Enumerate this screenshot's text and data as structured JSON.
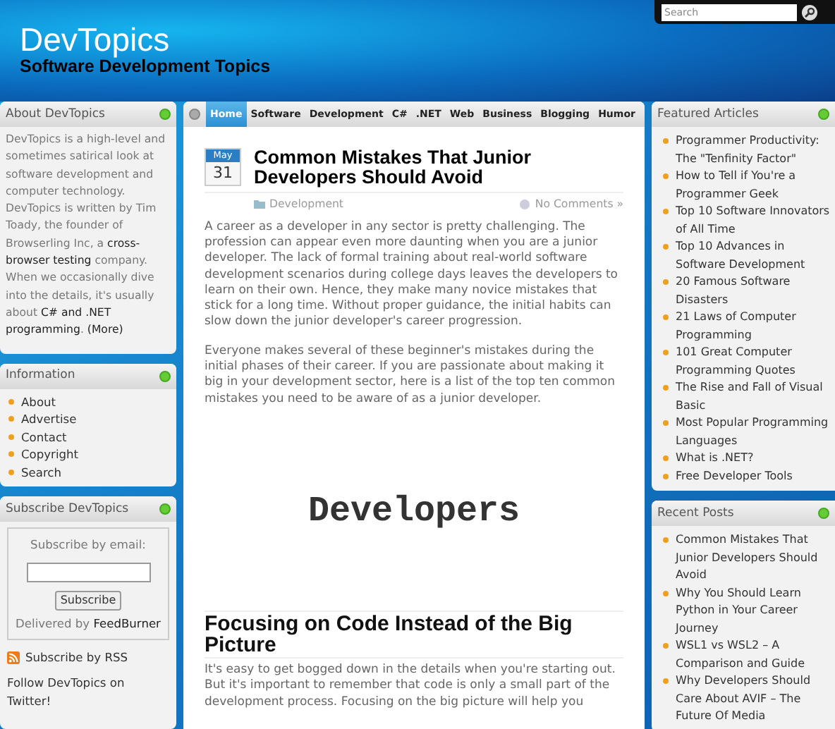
{
  "header": {
    "title": "DevTopics",
    "tagline": "Software Development Topics",
    "search": {
      "placeholder": "Search"
    }
  },
  "nav": [
    {
      "label": "Home",
      "selected": true
    },
    {
      "label": "Software",
      "selected": false
    },
    {
      "label": "Development",
      "selected": false
    },
    {
      "label": "C#",
      "selected": false
    },
    {
      "label": ".NET",
      "selected": false
    },
    {
      "label": "Web",
      "selected": false
    },
    {
      "label": "Business",
      "selected": false
    },
    {
      "label": "Blogging",
      "selected": false
    },
    {
      "label": "Humor",
      "selected": false
    }
  ],
  "left_sidebar": [
    {
      "kind": "text",
      "title": "About DevTopics",
      "body": "DevTopics is a high-level and sometimes satirical look at software development and computer technology. DevTopics is written by Tim Toady, the founder of Browserling Inc, a **cross-browser testing** company. When we occasionally dive into the details, it's usually about **C# and .NET programming**. **(More)**"
    },
    {
      "kind": "list",
      "title": "Information",
      "items": [
        "About",
        "Advertise",
        "Contact",
        "Copyright",
        "Search"
      ]
    },
    {
      "kind": "subscribe",
      "title": "Subscribe DevTopics",
      "prompt": "Subscribe by email:",
      "button": "Subscribe",
      "delivered": "Delivered by **FeedBurner**",
      "rss": "Subscribe by RSS",
      "follow": "Follow DevTopics on Twitter!"
    }
  ],
  "post": {
    "date": {
      "month": "May",
      "day": "31"
    },
    "title": "Common Mistakes That Junior Developers Should Avoid",
    "category": "Development",
    "comments": "No Comments »",
    "paragraphs": [
      "A career as a developer in any sector is pretty challenging. The profession can appear even more daunting when you are a junior developer. The lack of formal training about real-world software development scenarios during college days leaves the developers to learn on their own. Hence, they make many novice mistakes that stick for a long time. Without proper guidance, the initial habits can slow down the junior developer's career progression.",
      "Everyone makes several of these beginner's mistakes during the initial phases of their career. If you are passionate about making it big in your development sector, here is a list of the top ten common mistakes you need to be aware of as a junior developer."
    ],
    "figure_text": "Developers",
    "section_heading": "Focusing on Code Instead of the Big Picture",
    "section_paragraph": "It's easy to get bogged down in the details when you're starting out. But it's important to remember that code is only a small part of the development process. Focusing on the big picture will help you"
  },
  "right_sidebar": [
    {
      "title": "Featured Articles",
      "items": [
        "Programmer Productivity: The \"Tenfinity Factor\"",
        "How to Tell if You're a Programmer Geek",
        "Top 10 Software Innovators of All Time",
        "Top 10 Advances in Software Development",
        "20 Famous Software Disasters",
        "21 Laws of Computer Programming",
        "101 Great Computer Programming Quotes",
        "The Rise and Fall of Visual Basic",
        "Most Popular Programming Languages",
        "What is .NET?",
        "Free Developer Tools"
      ]
    },
    {
      "title": "Recent Posts",
      "items": [
        "Common Mistakes That Junior Developers Should Avoid",
        "Why You Should Learn Python in Your Career Journey",
        "WSL1 vs WSL2 – A Comparison and Guide",
        "Why Developers Should Care About AVIF – The Future Of Media"
      ]
    }
  ]
}
